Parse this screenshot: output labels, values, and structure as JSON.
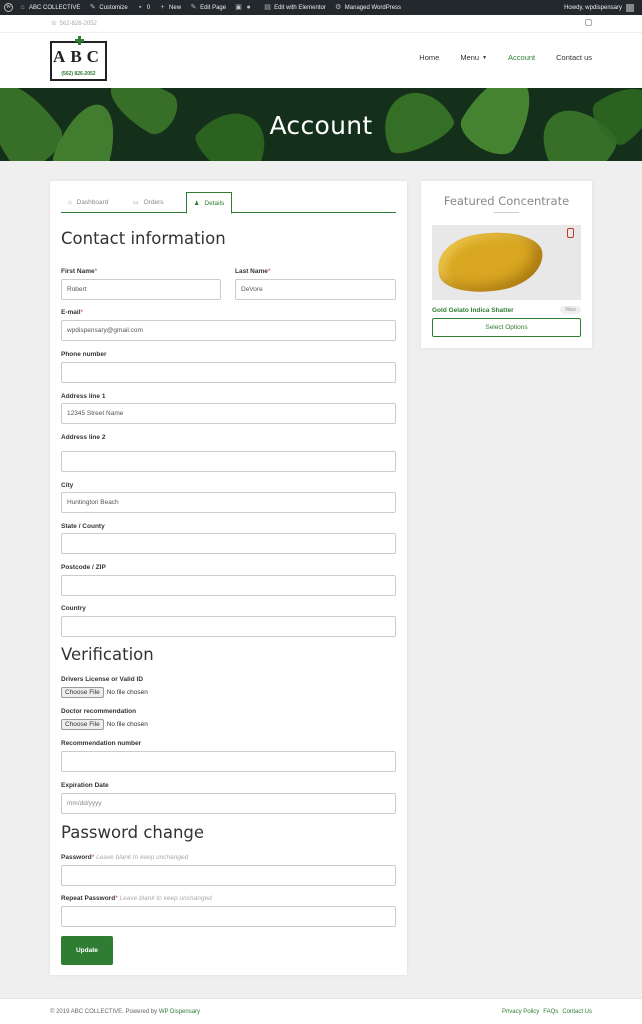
{
  "adminbar": {
    "site_name": "ABC COLLECTIVE",
    "customize": "Customize",
    "comments_count": "0",
    "new": "New",
    "edit_page": "Edit Page",
    "elementor": "Edit with Elementor",
    "managed": "Managed WordPress",
    "howdy": "Howdy, wpdispensary"
  },
  "topbar": {
    "phone": "562-826-2052"
  },
  "logo": {
    "letters": "ABC",
    "phone": "(562) 826-2052"
  },
  "nav": {
    "items": [
      {
        "label": "Home"
      },
      {
        "label": "Menu"
      },
      {
        "label": "Account"
      },
      {
        "label": "Contact us"
      }
    ]
  },
  "hero": {
    "title": "Account"
  },
  "tabs": [
    {
      "label": "Dashboard",
      "icon": "home-icon"
    },
    {
      "label": "Orders",
      "icon": "orders-icon"
    },
    {
      "label": "Details",
      "icon": "user-icon"
    }
  ],
  "contact": {
    "heading": "Contact information",
    "first_name_label": "First Name",
    "first_name_value": "Robert",
    "last_name_label": "Last Name",
    "last_name_value": "DeVore",
    "email_label": "E-mail",
    "email_value": "wpdispensary@gmail.com",
    "phone_label": "Phone number",
    "phone_value": "",
    "address1_label": "Address line 1",
    "address1_value": "12345 Street Name",
    "address2_label": "Address line 2",
    "address2_value": "",
    "city_label": "City",
    "city_value": "Huntington Beach",
    "state_label": "State / County",
    "state_value": "",
    "postcode_label": "Postcode / ZIP",
    "postcode_value": "",
    "country_label": "Country",
    "country_value": ""
  },
  "verification": {
    "heading": "Verification",
    "license_label": "Drivers License or Valid ID",
    "doctor_label": "Doctor recommendation",
    "choose_file": "Choose File",
    "no_file": "No file chosen",
    "rec_number_label": "Recommendation number",
    "rec_number_value": "",
    "expiration_label": "Expiration Date",
    "expiration_placeholder": "mm/dd/yyyy"
  },
  "password": {
    "heading": "Password change",
    "password_label": "Password",
    "repeat_label": "Repeat Password",
    "hint": "Leave blank to keep unchanged"
  },
  "update_button": "Update",
  "required_mark": "*",
  "widget": {
    "title": "Featured Concentrate",
    "product_name": "Gold Gelato Indica Shatter",
    "badge": "Wax",
    "button": "Select Options"
  },
  "footer": {
    "copyright": "© 2019 ABC COLLECTIVE. Powered by",
    "powered_link": "WP Dispensary",
    "links": [
      {
        "label": "Privacy Policy"
      },
      {
        "label": "FAQs"
      },
      {
        "label": "Contact Us"
      }
    ]
  },
  "colors": {
    "accent": "#2e7d32",
    "adminbar": "#23282d",
    "required": "#c0392b"
  }
}
